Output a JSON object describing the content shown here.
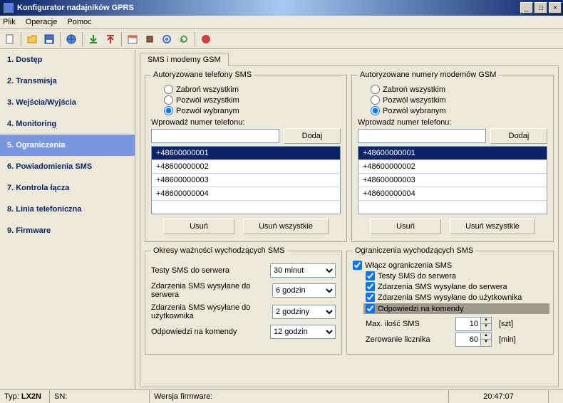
{
  "title": "Konfigurator nadajników GPRS",
  "menu": {
    "file": "Plik",
    "operations": "Operacje",
    "help": "Pomoc"
  },
  "sidebar": {
    "items": [
      {
        "label": "1. Dostęp"
      },
      {
        "label": "2. Transmisja"
      },
      {
        "label": "3. Wejścia/Wyjścia"
      },
      {
        "label": "4. Monitoring"
      },
      {
        "label": "5. Ograniczenia"
      },
      {
        "label": "6. Powiadomienia SMS"
      },
      {
        "label": "7. Kontrola łącza"
      },
      {
        "label": "8. Linia telefoniczna"
      },
      {
        "label": "9. Firmware"
      }
    ],
    "active_index": 4
  },
  "tab_label": "SMS i modemy GSM",
  "sms_phones": {
    "legend": "Autoryzowane telefony SMS",
    "radio": {
      "deny_all": "Zabroń wszystkim",
      "allow_all": "Pozwól wszystkim",
      "allow_selected": "Pozwól wybranym"
    },
    "radio_selected": "allow_selected",
    "input_label": "Wprowadź numer telefonu:",
    "input_value": "",
    "add_btn": "Dodaj",
    "list": [
      "+48600000001",
      "+48600000002",
      "+48600000003",
      "+48600000004"
    ],
    "selected_index": 0,
    "delete_btn": "Usuń",
    "delete_all_btn": "Usuń wszystkie"
  },
  "gsm_modems": {
    "legend": "Autoryzowane numery modemów GSM",
    "radio": {
      "deny_all": "Zabroń wszystkim",
      "allow_all": "Pozwól wszystkim",
      "allow_selected": "Pozwól wybranym"
    },
    "radio_selected": "allow_selected",
    "input_label": "Wprowadź numer telefonu:",
    "input_value": "",
    "add_btn": "Dodaj",
    "list": [
      "+48600000001",
      "+48600000002",
      "+48600000003",
      "+48600000004"
    ],
    "selected_index": 0,
    "delete_btn": "Usuń",
    "delete_all_btn": "Usuń wszystkie"
  },
  "periods": {
    "legend": "Okresy ważności wychodzących SMS",
    "rows": [
      {
        "label": "Testy SMS do serwera",
        "value": "30 minut"
      },
      {
        "label": "Zdarzenia SMS wysyłane do serwera",
        "value": "6 godzin"
      },
      {
        "label": "Zdarzenia SMS wysyłane do użytkownika",
        "value": "2 godziny"
      },
      {
        "label": "Odpowiedzi na komendy",
        "value": "12 godzin"
      }
    ]
  },
  "limits": {
    "legend": "Ograniczenia wychodzących SMS",
    "enable_label": "Włącz ograniczenia SMS",
    "enable_checked": true,
    "checks": [
      {
        "label": "Testy SMS do serwera",
        "checked": true
      },
      {
        "label": "Zdarzenia SMS wysyłane do serwera",
        "checked": true
      },
      {
        "label": "Zdarzenia SMS wysyłane do użytkownika",
        "checked": true
      },
      {
        "label": "Odpowiedzi na komendy",
        "checked": true,
        "highlight": true
      }
    ],
    "max_sms_label": "Max. ilość SMS",
    "max_sms_value": "10",
    "max_sms_unit": "[szt]",
    "reset_label": "Zerowanie licznika",
    "reset_value": "60",
    "reset_unit": "[min]"
  },
  "status": {
    "type_label": "Typ:",
    "type_value": "LX2N",
    "sn_label": "SN:",
    "fw_label": "Wersja firmware:",
    "time": "20:47:07"
  }
}
